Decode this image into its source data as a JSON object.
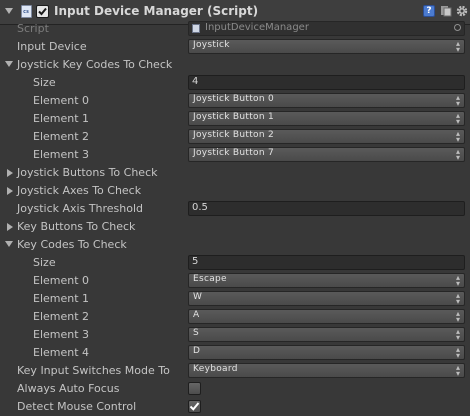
{
  "header": {
    "title": "Input Device Manager (Script)",
    "icons": [
      "fold-arrow-icon",
      "script-icon",
      "enabled-checkbox",
      "help-icon",
      "preset-icon",
      "gear-icon"
    ]
  },
  "fields": {
    "script": {
      "label": "Script",
      "value": "InputDeviceManager"
    },
    "input_device": {
      "label": "Input Device",
      "value": "Joystick"
    },
    "joystick_key_codes": {
      "label": "Joystick Key Codes To Check",
      "size_label": "Size",
      "size_value": "4",
      "elements": [
        {
          "label": "Element 0",
          "value": "Joystick Button 0"
        },
        {
          "label": "Element 1",
          "value": "Joystick Button 1"
        },
        {
          "label": "Element 2",
          "value": "Joystick Button 2"
        },
        {
          "label": "Element 3",
          "value": "Joystick Button 7"
        }
      ]
    },
    "joystick_buttons": {
      "label": "Joystick Buttons To Check"
    },
    "joystick_axes": {
      "label": "Joystick Axes To Check"
    },
    "joystick_axis_threshold": {
      "label": "Joystick Axis Threshold",
      "value": "0.5"
    },
    "key_buttons": {
      "label": "Key Buttons To Check"
    },
    "key_codes": {
      "label": "Key Codes To Check",
      "size_label": "Size",
      "size_value": "5",
      "elements": [
        {
          "label": "Element 0",
          "value": "Escape"
        },
        {
          "label": "Element 1",
          "value": "W"
        },
        {
          "label": "Element 2",
          "value": "A"
        },
        {
          "label": "Element 3",
          "value": "S"
        },
        {
          "label": "Element 4",
          "value": "D"
        }
      ]
    },
    "key_input_switch_mode": {
      "label": "Key Input Switches Mode To",
      "value": "Keyboard"
    },
    "always_auto_focus": {
      "label": "Always Auto Focus",
      "checked": false
    },
    "detect_mouse_control": {
      "label": "Detect Mouse Control",
      "checked": true
    }
  },
  "colors": {
    "background": "#383838",
    "header": "#3e3e3e",
    "text": "#c4c4c4",
    "dropdown": "#515151",
    "textbox": "#2d2d2d"
  }
}
